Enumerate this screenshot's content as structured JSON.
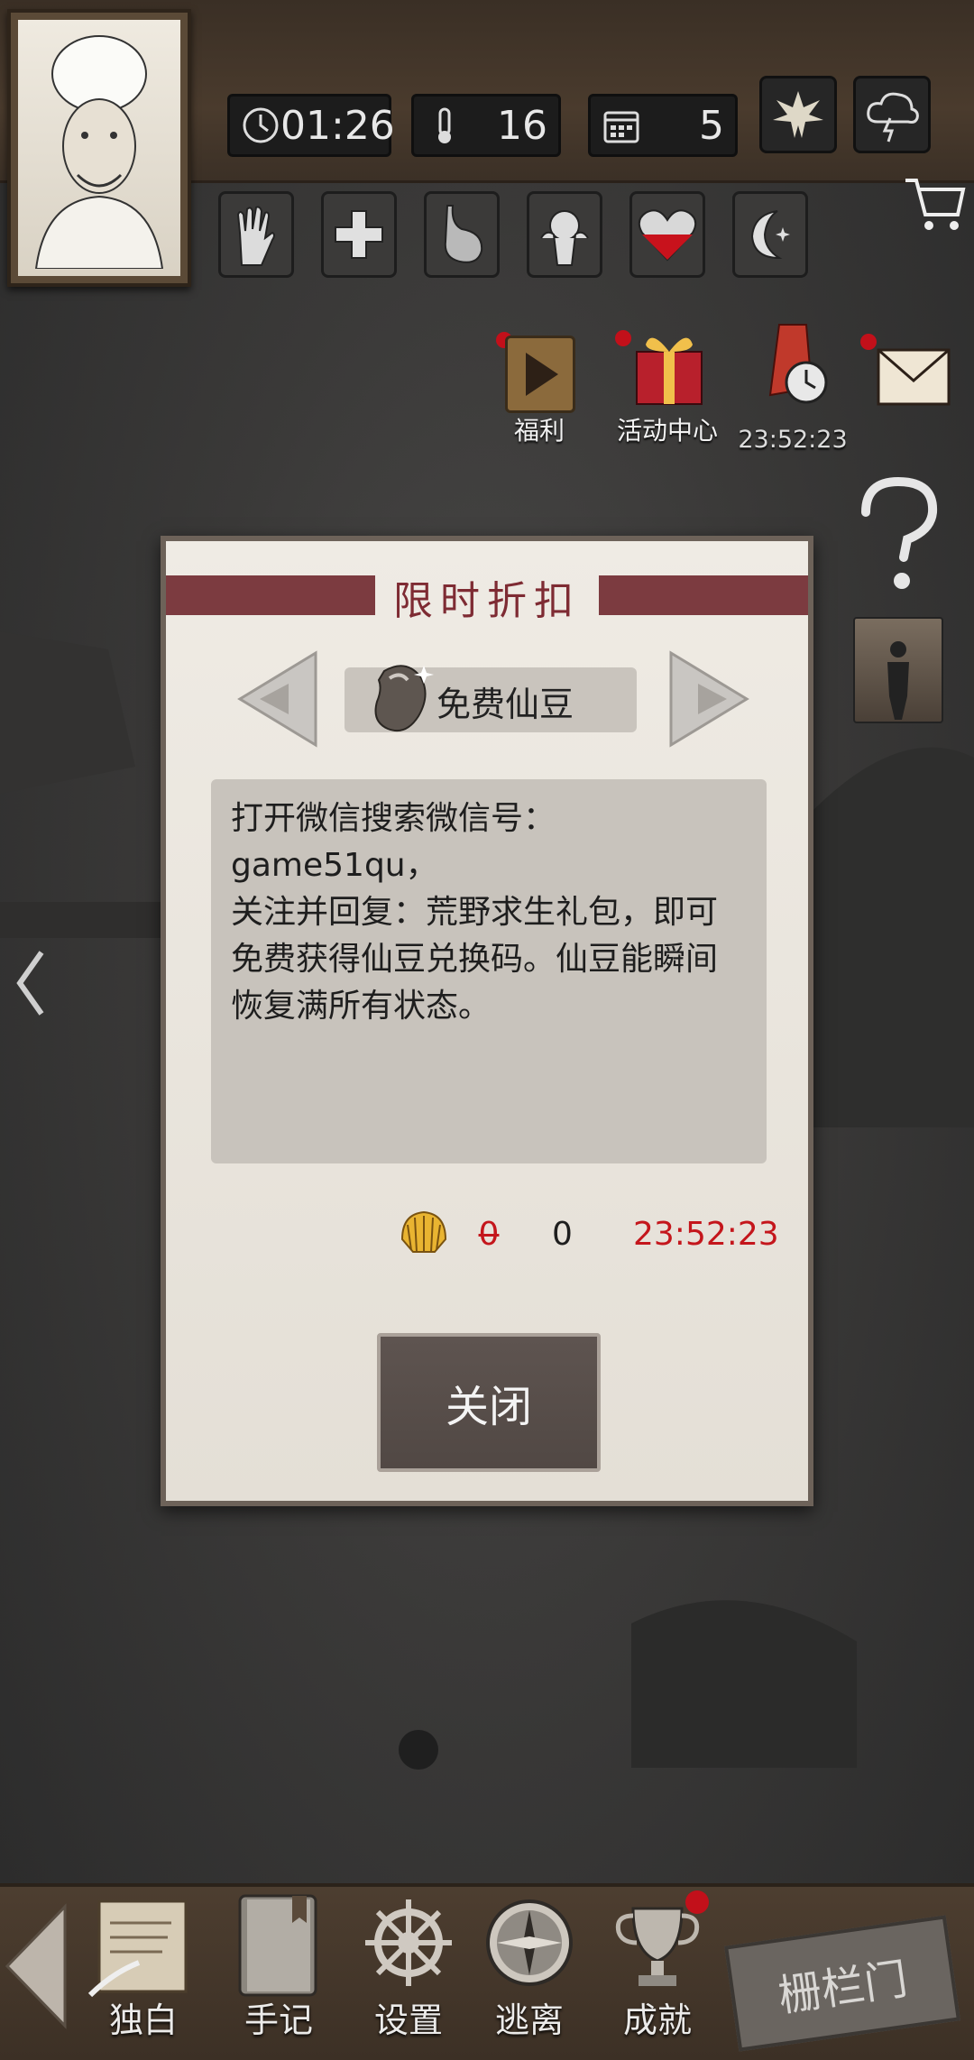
{
  "topbar": {
    "time": "01:26",
    "temperature": "16",
    "day": "5"
  },
  "events": {
    "welfare_label": "福利",
    "activity_label": "活动中心",
    "sale_timer": "23:52:23"
  },
  "dialog": {
    "title": "限时折扣",
    "item_name": "免费仙豆",
    "description": "打开微信搜索微信号：game51qu，\n关注并回复：荒野求生礼包，即可\n免费获得仙豆兑换码。仙豆能瞬间\n恢复满所有状态。",
    "old_price": "0",
    "new_price": "0",
    "timer": "23:52:23",
    "close_label": "关闭"
  },
  "bottom_nav": {
    "items": [
      {
        "label": "独白"
      },
      {
        "label": "手记"
      },
      {
        "label": "设置"
      },
      {
        "label": "逃离"
      },
      {
        "label": "成就"
      }
    ],
    "gate_label": "栅栏门"
  },
  "colors": {
    "banner": "#7c3b40",
    "price_red": "#c4161c",
    "notification": "#c2101a"
  }
}
